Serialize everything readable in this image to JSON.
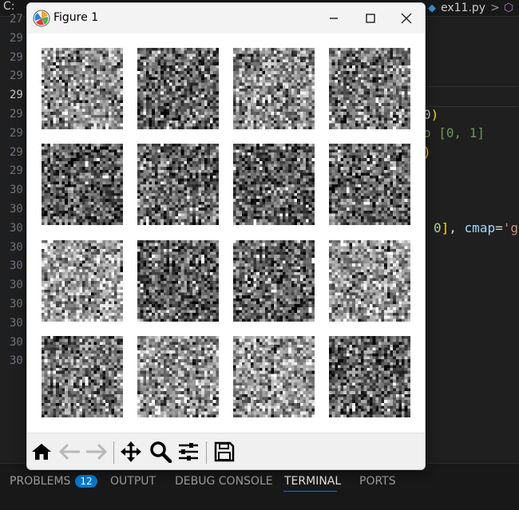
{
  "editor": {
    "corner_text": "C:",
    "file_tab": {
      "name": "ex11.py",
      "separator": ">"
    },
    "line_numbers": [
      "27",
      "29",
      "29",
      "29",
      "29",
      "29",
      "29",
      "29",
      "29",
      "30",
      "30",
      "30",
      "30",
      "30",
      "30",
      "30",
      "30",
      "30",
      "30"
    ],
    "active_line_index": 4,
    "code_fragments": [
      {
        "parts": [
          {
            "t": "0",
            "c": "num"
          },
          {
            "t": ")",
            "c": "paren"
          }
        ]
      },
      {
        "parts": [
          {
            "t": "o [0, 1]",
            "c": "comment"
          }
        ]
      },
      {
        "parts": [
          {
            "t": ")",
            "c": "paren"
          }
        ]
      },
      {
        "parts": [
          {
            "t": "0",
            "c": "num"
          },
          {
            "t": "]",
            "c": "paren"
          },
          {
            "t": ", ",
            "c": "punct"
          },
          {
            "t": "cmap",
            "c": "id"
          },
          {
            "t": "=",
            "c": "punct"
          },
          {
            "t": "'g",
            "c": "str"
          }
        ]
      }
    ]
  },
  "panel": {
    "tabs": [
      "PROBLEMS",
      "OUTPUT",
      "DEBUG CONSOLE",
      "TERMINAL",
      "PORTS"
    ],
    "problems_count": "12",
    "active_tab": "TERMINAL"
  },
  "figure_window": {
    "title": "Figure 1",
    "controls": [
      "minimize-icon",
      "maximize-icon",
      "close-icon"
    ],
    "grid": {
      "rows": 4,
      "cols": 4,
      "image_size": "28x28",
      "colormap": "gray",
      "content": "random noise"
    },
    "toolbar": [
      "home-icon",
      "back-arrow-icon",
      "forward-arrow-icon",
      "pan-move-icon",
      "zoom-magnifier-icon",
      "configure-subplots-icon",
      "save-disk-icon"
    ]
  }
}
